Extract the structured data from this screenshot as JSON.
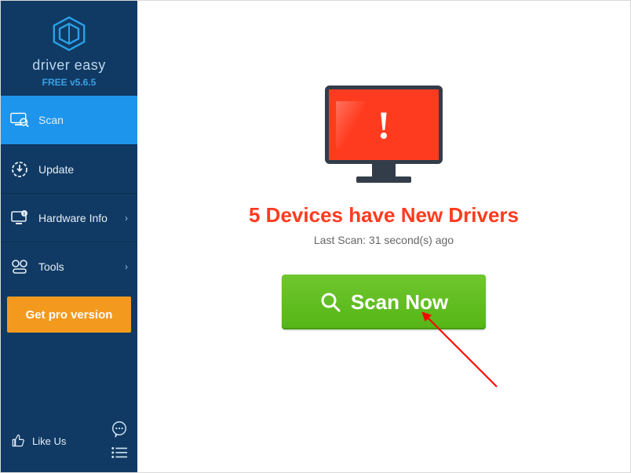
{
  "brand": {
    "name": "driver easy",
    "version": "FREE v5.6.5"
  },
  "sidebar": {
    "items": [
      {
        "label": "Scan"
      },
      {
        "label": "Update"
      },
      {
        "label": "Hardware Info"
      },
      {
        "label": "Tools"
      }
    ],
    "pro_label": "Get pro version",
    "like_label": "Like Us"
  },
  "main": {
    "headline": "5 Devices have New Drivers",
    "subline": "Last Scan: 31 second(s) ago",
    "scan_label": "Scan Now"
  },
  "colors": {
    "sidebar_bg": "#103a64",
    "active_bg": "#1e95ec",
    "accent_orange": "#f39a1e",
    "alert_red": "#ff3b1f",
    "button_green": "#55b516"
  }
}
